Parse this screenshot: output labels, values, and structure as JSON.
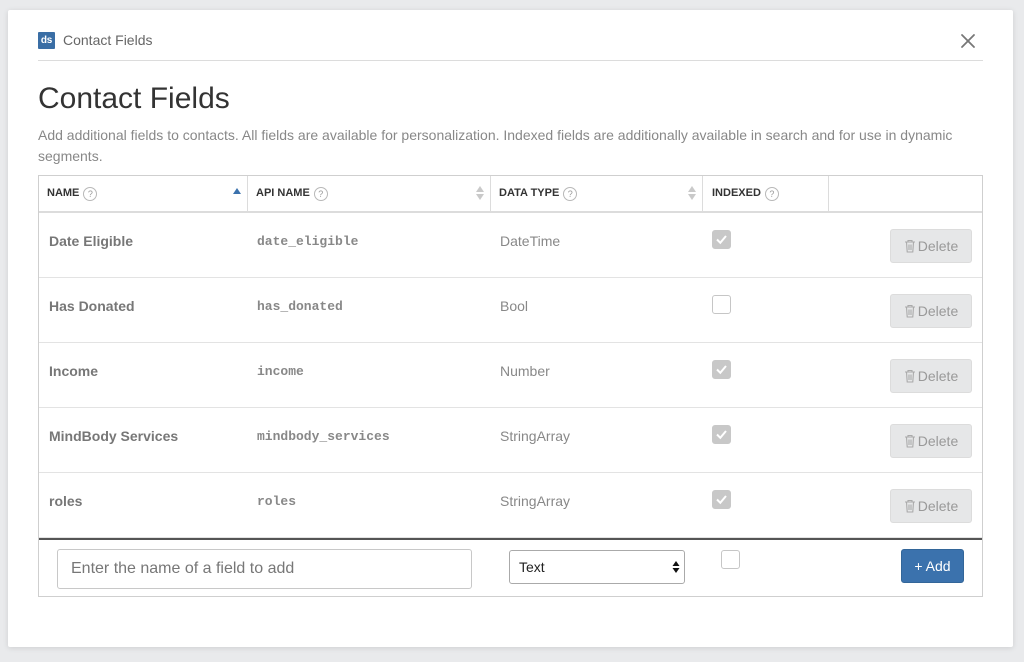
{
  "header": {
    "logo_text": "ds",
    "title": "Contact Fields",
    "close_icon": "close-icon"
  },
  "page": {
    "title": "Contact Fields",
    "description": "Add additional fields to contacts. All fields are available for personalization. Indexed fields are additionally available in search and for use in dynamic segments."
  },
  "table": {
    "columns": [
      {
        "label": "NAME",
        "help": "?",
        "sorted": "ascending"
      },
      {
        "label": "API NAME",
        "help": "?",
        "sortable": true
      },
      {
        "label": "DATA TYPE",
        "help": "?",
        "sortable": true
      },
      {
        "label": "INDEXED",
        "help": "?"
      },
      {
        "label": ""
      }
    ],
    "rows": [
      {
        "name": "Date Eligible",
        "api_name": "date_eligible",
        "data_type": "DateTime",
        "indexed": true,
        "action": "Delete"
      },
      {
        "name": "Has Donated",
        "api_name": "has_donated",
        "data_type": "Bool",
        "indexed": false,
        "action": "Delete"
      },
      {
        "name": "Income",
        "api_name": "income",
        "data_type": "Number",
        "indexed": true,
        "action": "Delete"
      },
      {
        "name": "MindBody Services",
        "api_name": "mindbody_services",
        "data_type": "StringArray",
        "indexed": true,
        "action": "Delete"
      },
      {
        "name": "roles",
        "api_name": "roles",
        "data_type": "StringArray",
        "indexed": true,
        "action": "Delete"
      }
    ]
  },
  "add_row": {
    "placeholder": "Enter the name of a field to add",
    "type_value": "Text",
    "indexed": false,
    "button_label": "+ Add"
  },
  "colors": {
    "accent": "#3b72ad",
    "logo": "#3a6ea5",
    "checkbox_checked": "#c8c8c8",
    "delete_button": "#e6e7e8"
  }
}
